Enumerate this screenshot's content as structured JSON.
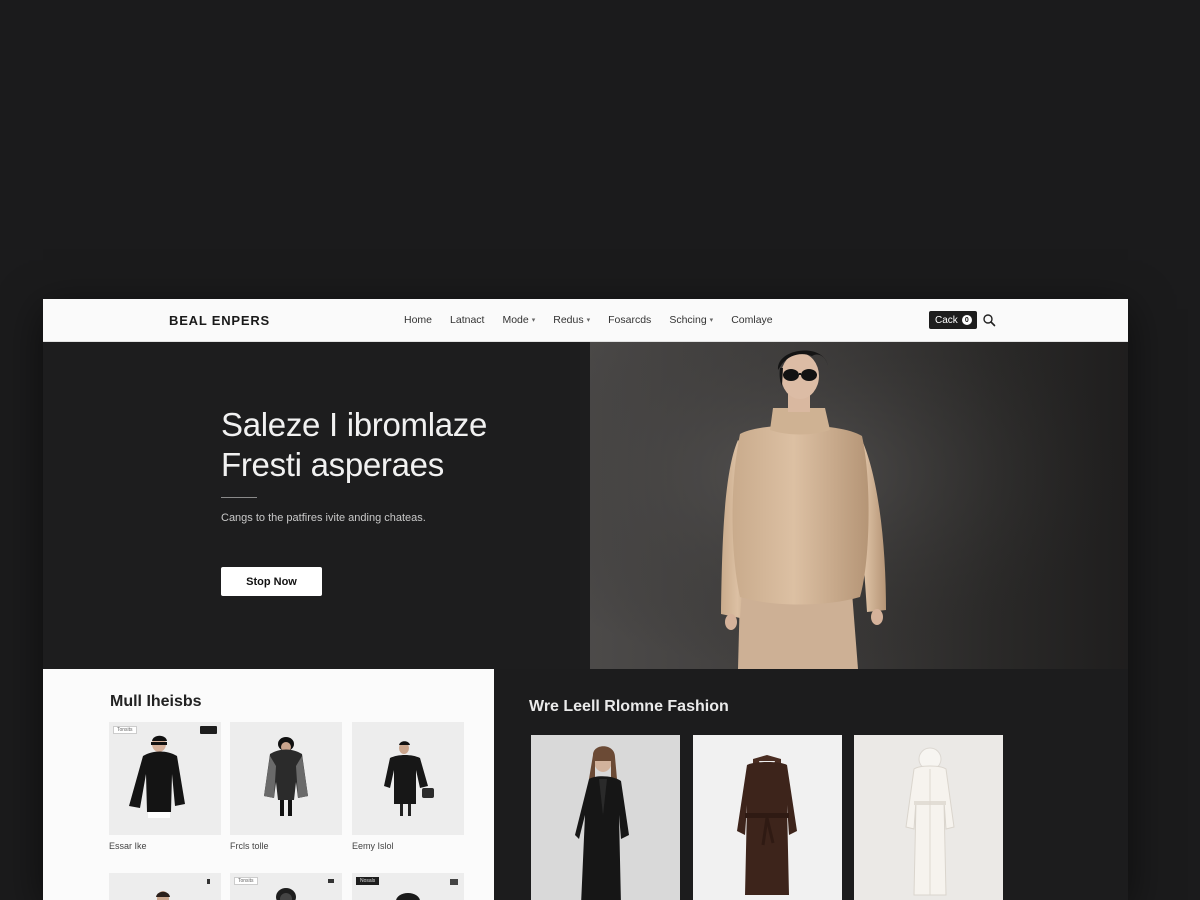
{
  "nav": {
    "brand": "BEAL ENPERS",
    "items": [
      {
        "label": "Home",
        "dropdown": false
      },
      {
        "label": "Latnact",
        "dropdown": false
      },
      {
        "label": "Mode",
        "dropdown": true
      },
      {
        "label": "Redus",
        "dropdown": true
      },
      {
        "label": "Fosarcds",
        "dropdown": false
      },
      {
        "label": "Schcing",
        "dropdown": true
      },
      {
        "label": "Comlaye",
        "dropdown": false
      }
    ],
    "cart_label": "Cack",
    "cart_count": "0",
    "search_icon": "search-icon"
  },
  "hero": {
    "title_line1": "Saleze I ibromlaze",
    "title_line2": "Fresti asperaes",
    "subtitle": "Cangs to the patfires ivite anding chateas.",
    "cta_label": "Stop Now"
  },
  "collection": {
    "title": "Mull Iheisbs",
    "products": [
      {
        "name": "Essar Ike",
        "tag": "Tonsits"
      },
      {
        "name": "Frcls tolle",
        "tag": ""
      },
      {
        "name": "Eemy Islol",
        "tag": ""
      }
    ],
    "second_row_tags": [
      "",
      "Tonsits",
      "Nosals"
    ]
  },
  "fashion": {
    "title": "Wre Leell Rlomne Fashion"
  },
  "colors": {
    "page_bg": "#1b1b1c",
    "nav_bg": "#fafafa",
    "hero_bg": "#1d1d1e",
    "accent_dark": "#1d1d1d",
    "sweater": "#d8bc9f"
  }
}
